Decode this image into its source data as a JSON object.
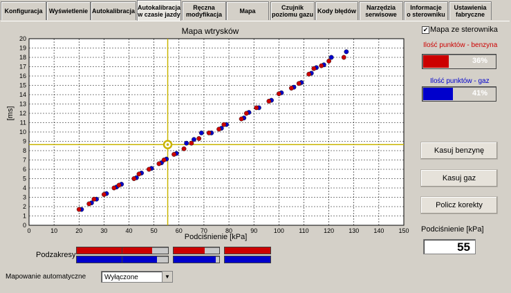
{
  "tabs": [
    {
      "label": "Konfiguracja"
    },
    {
      "label": "Wyświetlenie"
    },
    {
      "label": "Autokalibracja"
    },
    {
      "label": "Autokalibracja\nw czasie jazdy"
    },
    {
      "label": "Ręczna\nmodyfikacja"
    },
    {
      "label": "Mapa"
    },
    {
      "label": "Czujnik\npoziomu gazu"
    },
    {
      "label": "Kody błędów"
    },
    {
      "label": "Narzędzia\nserwisowe"
    },
    {
      "label": "Informacje\no sterowniku"
    },
    {
      "label": "Ustawienia\nfabryczne"
    }
  ],
  "active_tab": "Autokalibracja\nw czasie jazdy",
  "chart_data": {
    "type": "scatter",
    "title": "Mapa wtrysków",
    "xlabel": "Podciśnienie [kPa]",
    "ylabel": "[ms]",
    "xlim": [
      0,
      150
    ],
    "ylim": [
      0,
      20
    ],
    "xticks": [
      "0",
      "10",
      "20",
      "30",
      "40",
      "50",
      "60",
      "70",
      "80",
      "90",
      "100",
      "110",
      "120",
      "130",
      "140",
      "150"
    ],
    "yticks": [
      "0",
      "1",
      "2",
      "3",
      "4",
      "5",
      "6",
      "7",
      "8",
      "9",
      "10",
      "11",
      "12",
      "13",
      "14",
      "15",
      "16",
      "17",
      "18",
      "19",
      "20"
    ],
    "grid": true,
    "cursor": {
      "x": 55.5,
      "y": 8.65
    },
    "series": [
      {
        "color": "#0000cc",
        "points": [
          [
            21,
            1.7
          ],
          [
            25,
            2.4
          ],
          [
            27,
            2.8
          ],
          [
            31,
            3.4
          ],
          [
            35,
            4.1
          ],
          [
            37,
            4.4
          ],
          [
            43,
            5.1
          ],
          [
            45,
            5.6
          ],
          [
            49,
            6.1
          ],
          [
            53,
            6.7
          ],
          [
            55,
            7.1
          ],
          [
            59,
            7.7
          ],
          [
            63,
            8.8
          ],
          [
            66,
            9.2
          ],
          [
            69,
            9.9
          ],
          [
            73,
            9.9
          ],
          [
            77,
            10.4
          ],
          [
            79,
            10.8
          ],
          [
            86,
            11.5
          ],
          [
            88,
            12.1
          ],
          [
            92,
            12.6
          ],
          [
            97,
            13.4
          ],
          [
            101,
            14.2
          ],
          [
            106,
            14.8
          ],
          [
            109,
            15.3
          ],
          [
            113,
            16.3
          ],
          [
            115,
            16.9
          ],
          [
            118,
            17.2
          ],
          [
            121,
            18.0
          ],
          [
            127,
            18.6
          ]
        ]
      },
      {
        "color": "#cc0000",
        "points": [
          [
            20,
            1.7
          ],
          [
            24,
            2.3
          ],
          [
            26,
            2.8
          ],
          [
            30,
            3.3
          ],
          [
            34,
            4.0
          ],
          [
            36,
            4.3
          ],
          [
            42,
            5.0
          ],
          [
            44,
            5.5
          ],
          [
            48,
            6.0
          ],
          [
            52,
            6.6
          ],
          [
            54,
            7.0
          ],
          [
            58,
            7.6
          ],
          [
            62,
            8.2
          ],
          [
            65,
            8.8
          ],
          [
            68,
            9.3
          ],
          [
            72,
            9.9
          ],
          [
            76,
            10.3
          ],
          [
            78,
            10.8
          ],
          [
            85,
            11.4
          ],
          [
            87,
            12.0
          ],
          [
            91,
            12.6
          ],
          [
            96,
            13.3
          ],
          [
            100,
            14.1
          ],
          [
            105,
            14.7
          ],
          [
            108,
            15.2
          ],
          [
            112,
            16.2
          ],
          [
            114,
            16.8
          ],
          [
            117,
            17.1
          ],
          [
            120,
            17.6
          ],
          [
            126,
            18.0
          ]
        ]
      }
    ]
  },
  "right_panel": {
    "checkbox_label": "Mapa ze sterownika",
    "checkbox_checked": true,
    "benzyna_label": "Ilość punktów - benzyna",
    "benzyna_pct": "36%",
    "benzyna_value": 0.36,
    "benzyna_color": "#cc0000",
    "gaz_label": "Ilość punktów - gaz",
    "gaz_pct": "41%",
    "gaz_value": 0.41,
    "gaz_color": "#0000cc",
    "btn_kasuj_benzyne": "Kasuj benzynę",
    "btn_kasuj_gaz": "Kasuj gaz",
    "btn_policz": "Policz korekty",
    "pressure_label": "Podciśnienie [kPa]",
    "pressure_value": "55"
  },
  "podzakresy": {
    "label": "Podzakresy",
    "red": [
      1.0,
      0.65,
      0.68,
      1.0
    ],
    "blue": [
      1.0,
      0.75,
      0.93,
      1.0
    ]
  },
  "mapowanie": {
    "label": "Mapowanie automatyczne",
    "value": "Wyłączone"
  }
}
